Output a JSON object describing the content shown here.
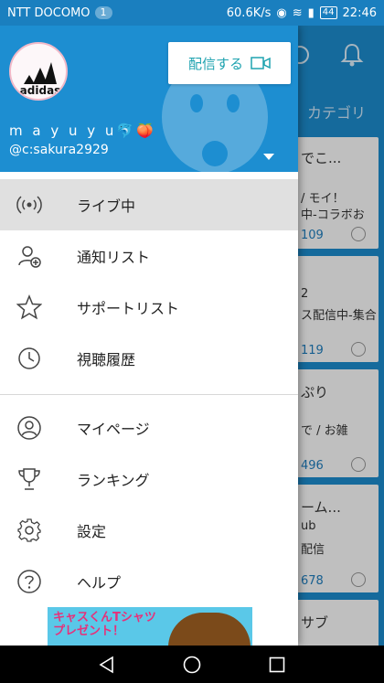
{
  "status_bar": {
    "carrier": "NTT DOCOMO",
    "notification_count": "1",
    "network_speed": "60.6K/s",
    "battery": "44",
    "time": "22:46"
  },
  "background": {
    "tab_label": "カテゴリ",
    "cards": [
      {
        "title": "でこ...",
        "line2": "/ モイ！",
        "line3": "中-コラボお",
        "count": "109"
      },
      {
        "title": "",
        "line2": "2",
        "line3": "ス配信中-集合",
        "count": "119"
      },
      {
        "title": "ぷり",
        "line2": "で / お雑",
        "line3": "",
        "count": "496"
      },
      {
        "title": "ーム...",
        "line2": "ub",
        "line3": "配信",
        "count": "678"
      },
      {
        "title": "サブ",
        "line2": "",
        "line3": "",
        "count": ""
      }
    ]
  },
  "drawer": {
    "broadcast_label": "配信する",
    "avatar_logo_text": "adidas",
    "username": "m a y u y u🐬🍑",
    "user_id": "@c:sakura2929",
    "menu": [
      {
        "label": "ライブ中",
        "icon": "live-broadcast-icon"
      },
      {
        "label": "通知リスト",
        "icon": "add-user-icon"
      },
      {
        "label": "サポートリスト",
        "icon": "star-icon"
      },
      {
        "label": "視聴履歴",
        "icon": "clock-icon"
      },
      {
        "label": "マイページ",
        "icon": "person-icon"
      },
      {
        "label": "ランキング",
        "icon": "trophy-icon"
      },
      {
        "label": "設定",
        "icon": "gear-icon"
      },
      {
        "label": "ヘルプ",
        "icon": "help-icon"
      }
    ],
    "promo_text": "キャスくんTシャツ\nプレゼント！"
  },
  "colors": {
    "header_blue": "#1d8ed1",
    "accent_teal": "#1fa3b0",
    "active_row": "#e0e0e0"
  }
}
